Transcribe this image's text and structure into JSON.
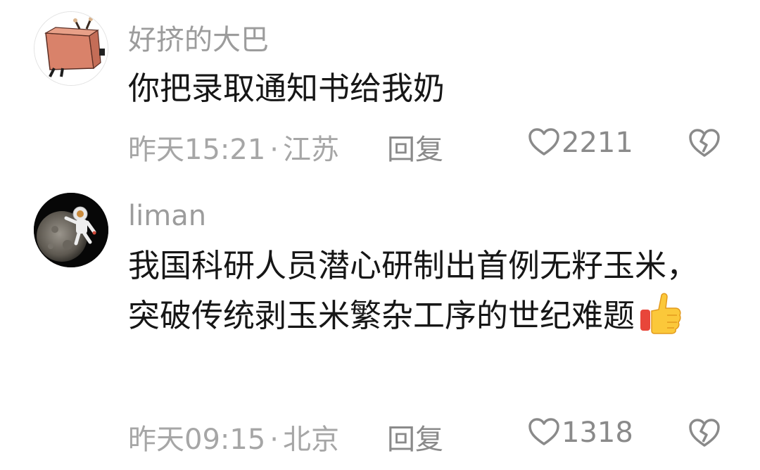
{
  "comments": [
    {
      "username": "好挤的大巴",
      "avatar": "cartoon-figure-in-box-icon",
      "text": "你把录取通知书给我奶",
      "time": "昨天15:21",
      "separator": "·",
      "location": "江苏",
      "reply_label": "回复",
      "likes": "2211"
    },
    {
      "username": "liman",
      "avatar": "astronaut-on-moon-icon",
      "text": "我国科研人员潜心研制出首例无籽玉米，突破传统剥玉米繁杂工序的世纪难题",
      "emoji": "thumbs-up-icon",
      "time": "昨天09:15",
      "separator": "·",
      "location": "北京",
      "reply_label": "回复",
      "likes": "1318"
    }
  ],
  "colors": {
    "username": "#9c9c9c",
    "text": "#161616",
    "meta": "#a6a6a6",
    "icon": "#8a8a8a"
  }
}
